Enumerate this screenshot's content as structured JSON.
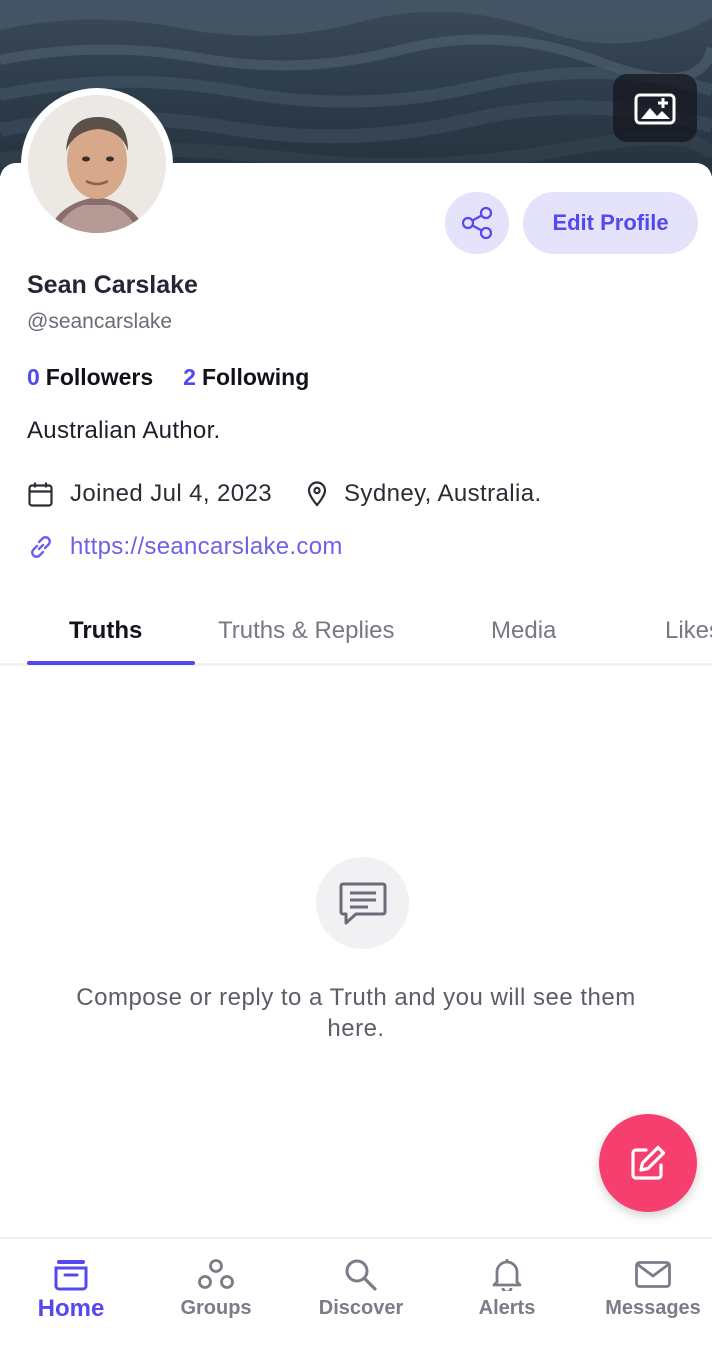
{
  "profile": {
    "display_name": "Sean Carslake",
    "handle": "@seancarslake",
    "followers_count": "0",
    "followers_label": "Followers",
    "following_count": "2",
    "following_label": "Following",
    "bio": "Australian Author.",
    "joined": "Joined Jul 4, 2023",
    "location": "Sydney, Australia.",
    "website": "https://seancarslake.com"
  },
  "actions": {
    "edit_profile_label": "Edit Profile"
  },
  "tabs": [
    {
      "label": "Truths",
      "active": true
    },
    {
      "label": "Truths & Replies",
      "active": false
    },
    {
      "label": "Media",
      "active": false
    },
    {
      "label": "Likes",
      "active": false
    }
  ],
  "empty_state": {
    "message": "Compose or reply to a Truth and you will see them here."
  },
  "bottom_nav": [
    {
      "label": "Home",
      "icon": "home-icon",
      "active": true
    },
    {
      "label": "Groups",
      "icon": "groups-icon",
      "active": false
    },
    {
      "label": "Discover",
      "icon": "search-icon",
      "active": false
    },
    {
      "label": "Alerts",
      "icon": "bell-icon",
      "active": false
    },
    {
      "label": "Messages",
      "icon": "mail-icon",
      "active": false
    }
  ],
  "colors": {
    "accent": "#5448ee",
    "accent_light": "#e4e3fb",
    "fab": "#f63f6e",
    "muted_text": "#787884"
  }
}
